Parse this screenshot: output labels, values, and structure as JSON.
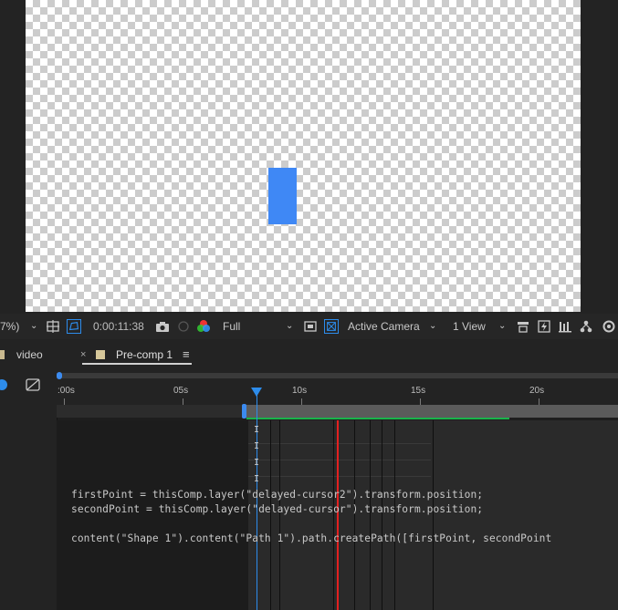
{
  "viewer_toolbar": {
    "magnification": "7%)",
    "timecode": "0:00:11:38",
    "resolution": "Full",
    "camera": "Active Camera",
    "view_layout": "1 View"
  },
  "tabs": [
    {
      "label": "video",
      "active": false
    },
    {
      "label": "Pre-comp 1",
      "active": true
    }
  ],
  "timeline": {
    "ruler_labels": [
      ":00s",
      "05s",
      "10s",
      "15s",
      "20s"
    ],
    "keyframe_marker": "I"
  },
  "expression": {
    "lines": [
      "firstPoint = thisComp.layer(\"delayed-cursor2\").transform.position;",
      "secondPoint = thisComp.layer(\"delayed-cursor\").transform.position;",
      "",
      "content(\"Shape 1\").content(\"Path 1\").path.createPath([firstPoint, secondPoint"
    ]
  },
  "colors": {
    "shape": "#3f88f5",
    "playhead": "#2d8ceb",
    "marker": "#e32020",
    "work_area_line": "#19b34a"
  }
}
